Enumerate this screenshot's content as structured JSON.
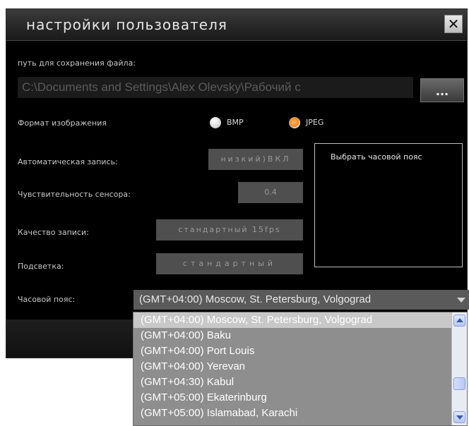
{
  "dialog": {
    "title": "настройки пользователя",
    "close_label": "✕"
  },
  "save_path": {
    "label": "путь для сохранения файла:",
    "value": "C:\\Documents and Settings\\Alex Olevsky\\Рабочий с",
    "browse_label": "..."
  },
  "image_format": {
    "label": "Формат изображения",
    "options": [
      "BMP",
      "JPEG"
    ],
    "selected": "JPEG"
  },
  "auto_record": {
    "label": "Автоматическая запись:",
    "value": "низкий)ВКЛ"
  },
  "sensitivity": {
    "label": "Чувствительность сенсора:",
    "value": "0.4"
  },
  "quality": {
    "label": "Качество записи:",
    "value": "стандартный 15fps"
  },
  "backlight": {
    "label": "Подсветка:",
    "value": "стандартный"
  },
  "timezone_panel": {
    "title": "Выбрать часовой пояс"
  },
  "timezone": {
    "label": "Часовой пояс:",
    "selected": "(GMT+04:00) Moscow, St. Petersburg, Volgograd",
    "options": [
      "(GMT+04:00) Moscow, St. Petersburg, Volgograd",
      "(GMT+04:00) Baku",
      "(GMT+04:00) Port Louis",
      "(GMT+04:00) Yerevan",
      "(GMT+04:30) Kabul",
      "(GMT+05:00) Ekaterinburg",
      "(GMT+05:00) Islamabad, Karachi"
    ]
  },
  "colors": {
    "radio_selected": "#f08a1c",
    "dialog_bg": "#000000"
  }
}
